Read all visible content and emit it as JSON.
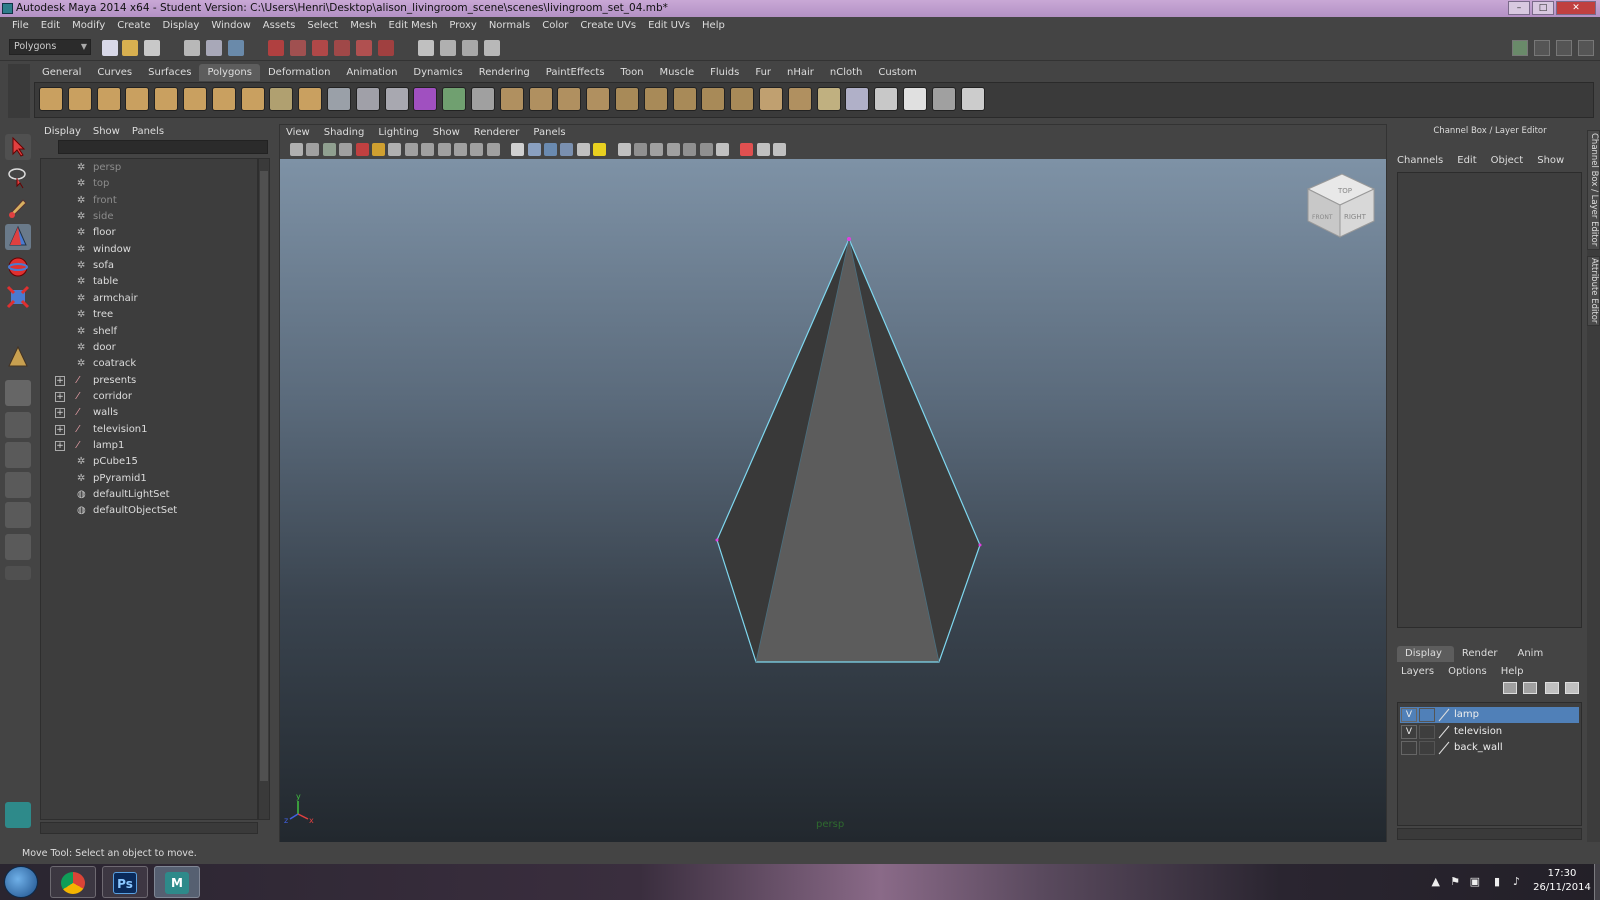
{
  "window": {
    "title": "Autodesk Maya 2014 x64 - Student Version: C:\\Users\\Henri\\Desktop\\alison_livingroom_scene\\scenes\\livingroom_set_04.mb*",
    "controls": {
      "minimize": "–",
      "maximize": "□",
      "close": "✕"
    }
  },
  "menubar": [
    "File",
    "Edit",
    "Modify",
    "Create",
    "Display",
    "Window",
    "Assets",
    "Select",
    "Mesh",
    "Edit Mesh",
    "Proxy",
    "Normals",
    "Color",
    "Create UVs",
    "Edit UVs",
    "Help"
  ],
  "status": {
    "mode": "Polygons"
  },
  "shelf": {
    "tabs": [
      "General",
      "Curves",
      "Surfaces",
      "Polygons",
      "Deformation",
      "Animation",
      "Dynamics",
      "Rendering",
      "PaintEffects",
      "Toon",
      "Muscle",
      "Fluids",
      "Fur",
      "nHair",
      "nCloth",
      "Custom"
    ],
    "active_tab": "Polygons"
  },
  "outliner": {
    "menu": [
      "Display",
      "Show",
      "Panels"
    ],
    "items": [
      {
        "label": "persp",
        "kind": "camera",
        "expandable": false
      },
      {
        "label": "top",
        "kind": "camera",
        "expandable": false
      },
      {
        "label": "front",
        "kind": "camera",
        "expandable": false
      },
      {
        "label": "side",
        "kind": "camera",
        "expandable": false
      },
      {
        "label": "floor",
        "kind": "mesh",
        "expandable": false
      },
      {
        "label": "window",
        "kind": "mesh",
        "expandable": false
      },
      {
        "label": "sofa",
        "kind": "mesh",
        "expandable": false
      },
      {
        "label": "table",
        "kind": "mesh",
        "expandable": false
      },
      {
        "label": "armchair",
        "kind": "mesh",
        "expandable": false
      },
      {
        "label": "tree",
        "kind": "mesh",
        "expandable": false
      },
      {
        "label": "shelf",
        "kind": "mesh",
        "expandable": false
      },
      {
        "label": "door",
        "kind": "mesh",
        "expandable": false
      },
      {
        "label": "coatrack",
        "kind": "mesh",
        "expandable": false
      },
      {
        "label": "presents",
        "kind": "group",
        "expandable": true
      },
      {
        "label": "corridor",
        "kind": "group",
        "expandable": true
      },
      {
        "label": "walls",
        "kind": "group",
        "expandable": true
      },
      {
        "label": "television1",
        "kind": "group",
        "expandable": true
      },
      {
        "label": "lamp1",
        "kind": "group",
        "expandable": true
      },
      {
        "label": "pCube15",
        "kind": "mesh",
        "expandable": false
      },
      {
        "label": "pPyramid1",
        "kind": "mesh",
        "expandable": false
      },
      {
        "label": "defaultLightSet",
        "kind": "set",
        "expandable": false
      },
      {
        "label": "defaultObjectSet",
        "kind": "set",
        "expandable": false
      }
    ]
  },
  "viewport": {
    "menu": [
      "View",
      "Shading",
      "Lighting",
      "Show",
      "Renderer",
      "Panels"
    ],
    "camera_label": "persp",
    "viewcube": {
      "top": "TOP",
      "front": "FRONT",
      "right": "RIGHT"
    },
    "axis": {
      "y": "y",
      "x": "x",
      "z": "z"
    }
  },
  "channel_box": {
    "header": "Channel Box / Layer Editor",
    "tabs": [
      "Channels",
      "Edit",
      "Object",
      "Show"
    ]
  },
  "layer_editor": {
    "tabs": [
      "Display",
      "Render",
      "Anim"
    ],
    "active_tab": "Display",
    "menu": [
      "Layers",
      "Options",
      "Help"
    ],
    "layers": [
      {
        "name": "lamp",
        "visible": "V",
        "selected": true
      },
      {
        "name": "television",
        "visible": "V",
        "selected": false
      },
      {
        "name": "back_wall",
        "visible": "",
        "selected": false
      }
    ]
  },
  "side_tabs": [
    "Channel Box / Layer Editor",
    "Attribute Editor"
  ],
  "help_line": "Move Tool: Select an object to move.",
  "taskbar": {
    "apps": [
      {
        "name": "chrome",
        "glyph": "",
        "active": false
      },
      {
        "name": "photoshop",
        "glyph": "Ps",
        "active": false
      },
      {
        "name": "maya",
        "glyph": "M",
        "active": true
      }
    ],
    "time": "17:30",
    "date": "26/11/2014"
  },
  "colors": {
    "selection_blue": "#5080b8",
    "wire_cyan": "#7fd8f0",
    "group_icon": "#e8a0a8"
  }
}
